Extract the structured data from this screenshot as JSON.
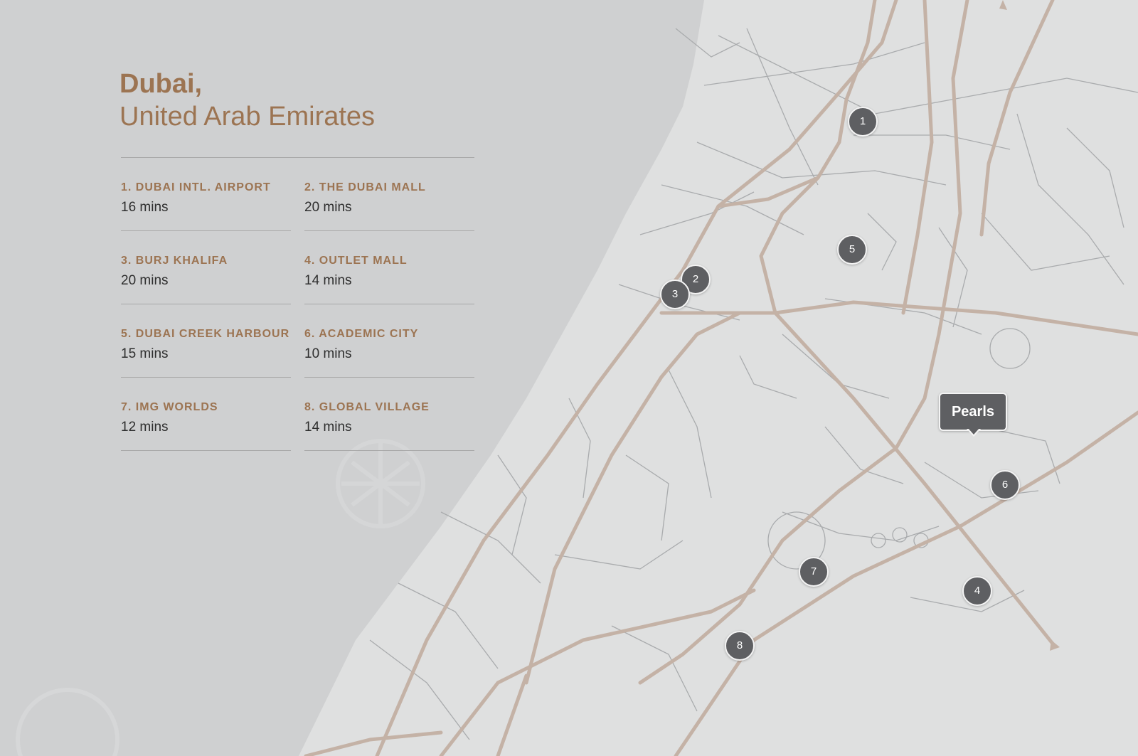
{
  "title": {
    "line1": "Dubai,",
    "line2": "United Arab Emirates"
  },
  "destinations": [
    {
      "label": "1. DUBAI INTL. AIRPORT",
      "time": "16 mins"
    },
    {
      "label": "2. THE DUBAI MALL",
      "time": "20 mins"
    },
    {
      "label": "3. BURJ KHALIFA",
      "time": "20 mins"
    },
    {
      "label": "4. OUTLET MALL",
      "time": "14 mins"
    },
    {
      "label": "5. DUBAI CREEK HARBOUR",
      "time": "15 mins"
    },
    {
      "label": "6. ACADEMIC CITY",
      "time": "10 mins"
    },
    {
      "label": "7. IMG WORLDS",
      "time": "12 mins"
    },
    {
      "label": "8. GLOBAL VILLAGE",
      "time": "14 mins"
    }
  ],
  "markers": [
    "1",
    "2",
    "3",
    "4",
    "5",
    "6",
    "7",
    "8"
  ],
  "project_pin": {
    "label": "Pearls"
  },
  "colors": {
    "sea": "#cfd0d1",
    "land": "#dfe0e0",
    "major_road": "#c4b2a6",
    "minor_road": "#a9abad",
    "accent": "#9c7452",
    "marker": "#5e5f62"
  }
}
